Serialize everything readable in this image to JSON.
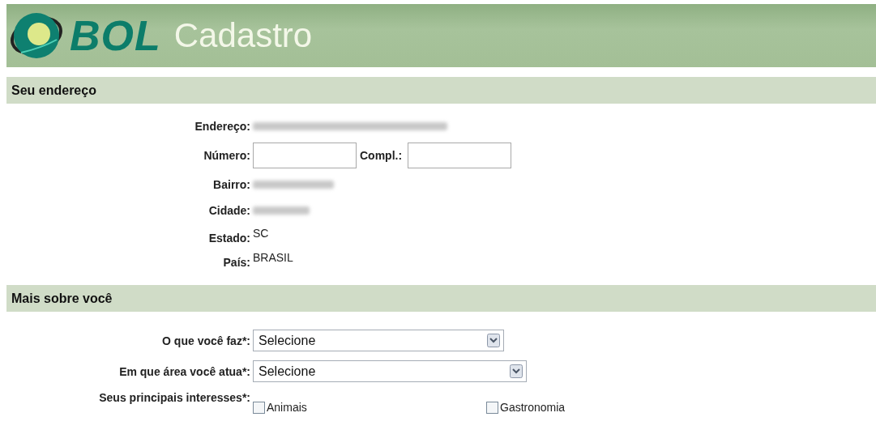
{
  "header": {
    "brand": "BOL",
    "title": "Cadastro"
  },
  "address": {
    "heading": "Seu endereço",
    "rows": [
      {
        "kind": "redacted",
        "label": "Endereço:"
      },
      {
        "kind": "inputs",
        "label": "Número:",
        "second_label": "Compl.:"
      },
      {
        "kind": "redacted",
        "label": "Bairro:"
      },
      {
        "kind": "redacted",
        "label": "Cidade:"
      },
      {
        "kind": "text",
        "label": "Estado:",
        "value": "SC"
      },
      {
        "kind": "text",
        "label": "País:",
        "value": "BRASIL"
      }
    ]
  },
  "about": {
    "heading": "Mais sobre você",
    "selects": [
      {
        "label": "O que você faz*:",
        "value": "Selecione",
        "wide": false
      },
      {
        "label": "Em que área você atua*:",
        "value": "Selecione",
        "wide": true
      }
    ],
    "interests": {
      "label": "Seus principais interesses*:",
      "options": [
        {
          "label": "Animais",
          "checked": false
        },
        {
          "label": "Gastronomia",
          "checked": false
        }
      ]
    }
  }
}
